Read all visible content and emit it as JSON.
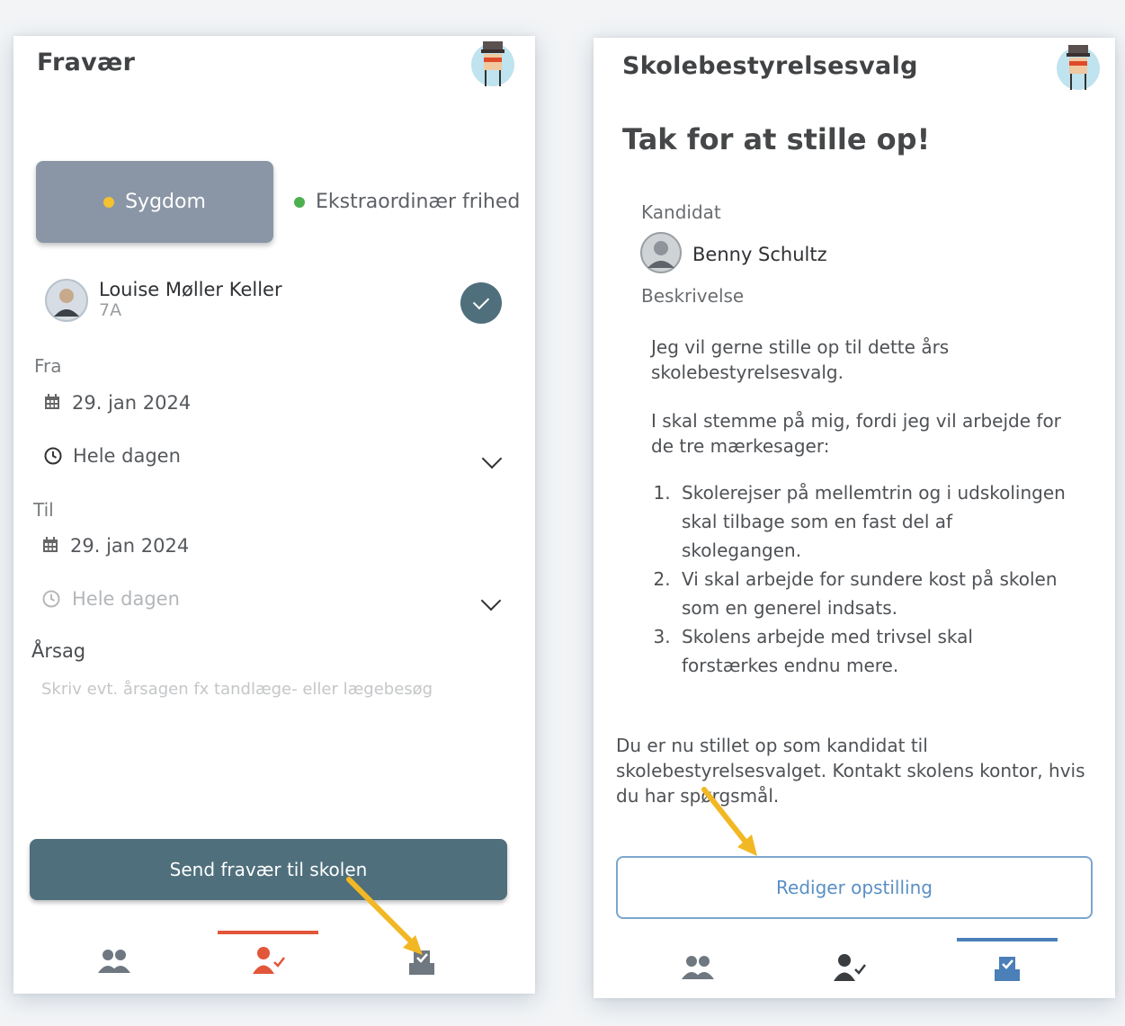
{
  "left": {
    "title": "Fravær",
    "tabs": {
      "sick": "Sygdom",
      "extra": "Ekstraordinær frihed"
    },
    "student": {
      "name": "Louise Møller Keller",
      "class": "7A"
    },
    "from": {
      "label": "Fra",
      "date": "29. jan 2024",
      "time": "Hele dagen"
    },
    "to": {
      "label": "Til",
      "date": "29. jan 2024",
      "time": "Hele dagen"
    },
    "reason": {
      "label": "Årsag",
      "placeholder": "Skriv evt. årsagen fx tandlæge- eller lægebesøg"
    },
    "send_label": "Send fravær til skolen",
    "nav": {
      "active_index": 1
    }
  },
  "right": {
    "title": "Skolebestyrelsesvalg",
    "heading": "Tak for at stille op!",
    "candidate_label": "Kandidat",
    "candidate_name": "Benny Schultz",
    "description_label": "Beskrivelse",
    "description": {
      "p1": "Jeg vil gerne stille op til dette års skolebestyrelsesvalg.",
      "p2": "I skal stemme på mig, fordi jeg vil arbejde for de tre mærkesager:",
      "items": [
        "Skolerejser på mellemtrin og i udskolingen skal tilbage som en fast del af skolegangen.",
        "Vi skal arbejde for sundere kost på skolen som en generel indsats.",
        "Skolens arbejde med trivsel skal forstærkes endnu mere."
      ]
    },
    "info": "Du er nu stillet op som kandidat til skolebestyrelsesvalget. Kontakt skolens kontor, hvis du har spørgsmål.",
    "edit_label": "Rediger opstilling",
    "nav": {
      "active_index": 2
    }
  },
  "colors": {
    "primary": "#4f6f7c",
    "active_red": "#e2563a",
    "active_blue": "#4a7fb8",
    "sick_dot": "#f2c230",
    "extra_dot": "#4caf50",
    "annotation_arrow": "#f2b824"
  }
}
